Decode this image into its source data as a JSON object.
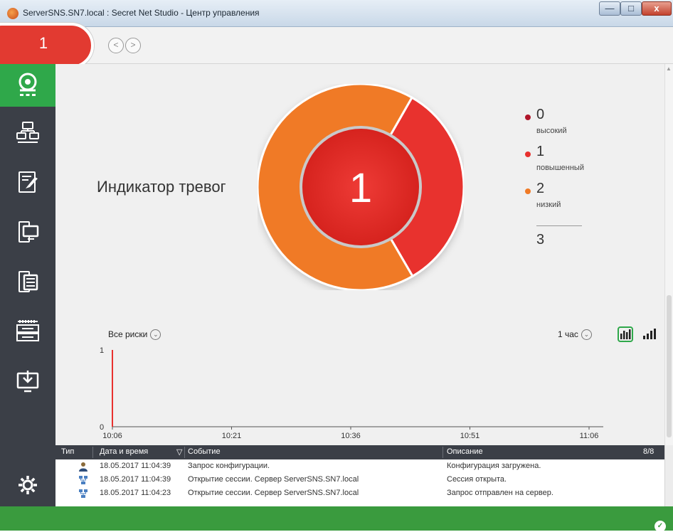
{
  "window": {
    "title": "ServerSNS.SN7.local : Secret Net Studio - Центр управления",
    "minimize": "—",
    "maximize": "□",
    "close": "x"
  },
  "toolbar": {
    "alarm_count": "1",
    "back": "<",
    "forward": ">"
  },
  "sidebar": {
    "items": [
      {
        "id": "dashboard",
        "icon": "dashboard-icon",
        "active": true
      },
      {
        "id": "network",
        "icon": "network-icon"
      },
      {
        "id": "journals",
        "icon": "journal-icon"
      },
      {
        "id": "computers",
        "icon": "computer-icon"
      },
      {
        "id": "servers",
        "icon": "server-icon"
      },
      {
        "id": "racks",
        "icon": "rack-icon"
      },
      {
        "id": "deploy",
        "icon": "download-icon"
      },
      {
        "id": "settings",
        "icon": "gear-icon"
      }
    ]
  },
  "alarm_indicator": {
    "title": "Индикатор тревог",
    "center_value": "1",
    "legend": [
      {
        "value": "0",
        "label": "высокий",
        "color": "#b0162a"
      },
      {
        "value": "1",
        "label": "повышенный",
        "color": "#e8312e"
      },
      {
        "value": "2",
        "label": "низкий",
        "color": "#f07a25"
      }
    ],
    "total": "3"
  },
  "risk_chart": {
    "filter_label": "Все риски",
    "period_label": "1 час",
    "chart_data": {
      "type": "bar",
      "x": [
        "10:06"
      ],
      "values": [
        1
      ],
      "x_ticks": [
        "10:06",
        "10:21",
        "10:36",
        "10:51",
        "11:06"
      ],
      "y_ticks": [
        "0",
        "1"
      ],
      "ylim": [
        0,
        1
      ],
      "grid": false,
      "color": "#e8312e"
    }
  },
  "events_table": {
    "headers": {
      "type": "Тип",
      "datetime": "Дата и время",
      "event": "Событие",
      "description": "Описание",
      "count": "8/8"
    },
    "rows": [
      {
        "icon": "user-icon",
        "datetime": "18.05.2017 11:04:39",
        "event": "Запрос конфигурации.",
        "description": "Конфигурация загружена."
      },
      {
        "icon": "network-session-icon",
        "datetime": "18.05.2017 11:04:39",
        "event": "Открытие сессии. Сервер ServerSNS.SN7.local",
        "description": "Сессия открыта."
      },
      {
        "icon": "network-session-icon",
        "datetime": "18.05.2017 11:04:23",
        "event": "Открытие сессии. Сервер ServerSNS.SN7.local",
        "description": "Запрос отправлен на сервер."
      }
    ]
  },
  "status": {
    "check": "✓",
    "color": "#3a9b3e"
  }
}
